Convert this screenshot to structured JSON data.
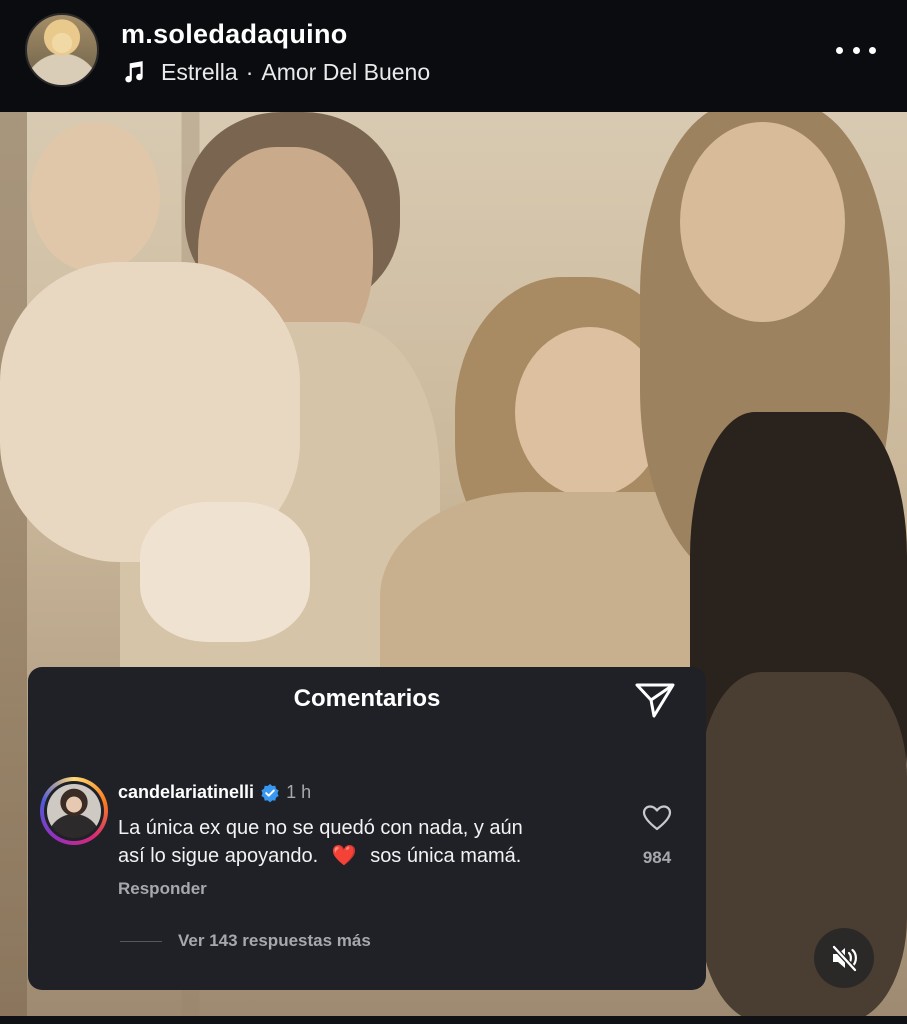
{
  "header": {
    "username": "m.soledadaquino",
    "song_title": "Estrella",
    "song_separator": "·",
    "song_artist": "Amor Del Bueno",
    "music_icon": "music-note-icon",
    "more_icon": "more-horizontal-icon"
  },
  "photo": {
    "description_icon": "family-photo"
  },
  "comments_panel": {
    "title": "Comentarios",
    "share_icon": "send-icon",
    "comment": {
      "username": "candelariatinelli",
      "verified_icon": "verified-badge-icon",
      "time": "1 h",
      "text_line1": "La única ex que no se quedó con nada, y aún",
      "text_line2_a": "así lo sigue apoyando.",
      "text_emoji": "❤️",
      "text_line2_b": "sos única mamá.",
      "like_icon": "heart-outline-icon",
      "like_count": "984",
      "reply_label": "Responder"
    },
    "view_replies": "Ver 143 respuestas más"
  },
  "controls": {
    "mute_icon": "muted-speaker-icon"
  },
  "colors": {
    "header_bg": "#0b0c10",
    "panel_bg": "#1f2127",
    "muted_text": "#a6a8ae",
    "verified_blue": "#3897f0",
    "heart_red": "#e21f2b"
  }
}
